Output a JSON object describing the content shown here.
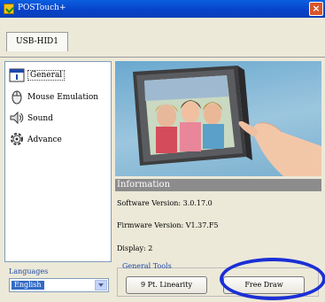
{
  "window": {
    "title": "POSTouch+",
    "close_label": "×"
  },
  "tabs": [
    {
      "label": "USB-HID1"
    }
  ],
  "nav": {
    "items": [
      {
        "label": "General",
        "icon": "info-icon",
        "selected": true
      },
      {
        "label": "Mouse Emulation",
        "icon": "mouse-icon",
        "selected": false
      },
      {
        "label": "Sound",
        "icon": "speaker-icon",
        "selected": false
      },
      {
        "label": "Advance",
        "icon": "gear-icon",
        "selected": false
      }
    ]
  },
  "language": {
    "label": "Languages",
    "value": "English"
  },
  "information": {
    "header": "Information",
    "software": "Software Version: 3.0.17.0",
    "firmware": "Firmware Version: V1.37.F5",
    "display": "Display: 2"
  },
  "tools": {
    "label": "General Tools",
    "linearity_button": "9 Pt. Linearity",
    "free_draw_button": "Free Draw"
  },
  "colors": {
    "titlebar": "#0841c8",
    "accent_label": "#1f49a8",
    "highlight_ellipse": "#1b2fd6",
    "info_header": "#8c8c8c"
  }
}
